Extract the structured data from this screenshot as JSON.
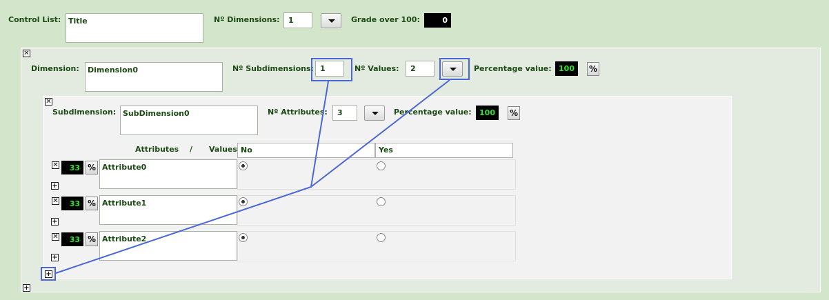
{
  "control_list": {
    "label": "Control List:",
    "title_value": "Title",
    "dimensions_label": "Nº Dimensions:",
    "dimensions_value": "1",
    "grade_label": "Grade over 100:",
    "grade_value": "0"
  },
  "dimension": {
    "label": "Dimension:",
    "name_value": "Dimension0",
    "subdimensions_label": "Nº Subdimensions:",
    "subdimensions_value": "1",
    "values_label": "Nº Values:",
    "values_value": "2",
    "percentage_label": "Percentage value:",
    "percentage_value": "100"
  },
  "subdimension": {
    "label": "Subdimension:",
    "name_value": "SubDimension0",
    "attributes_label": "Nº Attributes:",
    "attributes_value": "3",
    "percentage_label": "Percentage value:",
    "percentage_value": "100"
  },
  "attributes_table": {
    "attributes_header": "Attributes",
    "separator": "/",
    "values_header": "Values",
    "value_columns": [
      "No",
      "Yes"
    ],
    "rows": [
      {
        "weight": "33",
        "name": "Attribute0",
        "selected": "No"
      },
      {
        "weight": "33",
        "name": "Attribute1",
        "selected": "No"
      },
      {
        "weight": "33",
        "name": "Attribute2",
        "selected": "No"
      }
    ]
  },
  "icons": {
    "remove": "close-icon",
    "add": "plus-icon",
    "percent": "percent-icon",
    "dropdown": "chevron-down-icon"
  },
  "glyphs": {
    "remove": "✕",
    "add": "+",
    "percent": "%"
  },
  "colors": {
    "background": "#d3e6cb",
    "dimension_panel": "#e3ebe0",
    "subdimension_panel": "#f2f2f2",
    "label_text": "#1c4a14",
    "percentage_text": "#2ee62e",
    "highlight": "#4a67d6"
  }
}
